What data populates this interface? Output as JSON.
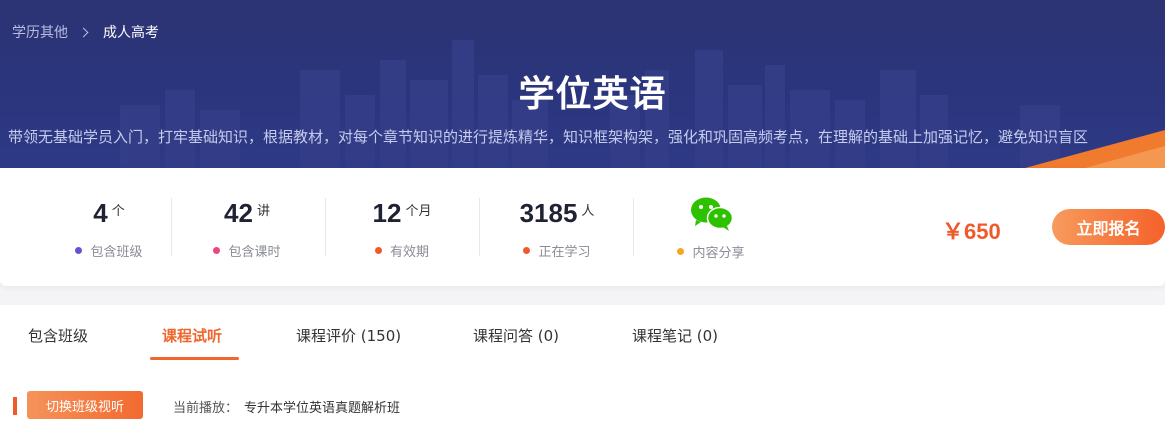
{
  "breadcrumb": {
    "parent": "学历其他",
    "current": "成人高考"
  },
  "title": "学位英语",
  "description": "带领无基础学员入门，打牢基础知识，根据教材，对每个章节知识的进行提炼精华，知识框架构架，强化和巩固高频考点，在理解的基础上加强记忆，避免知识盲区",
  "stats": [
    {
      "value": "4",
      "unit": "个",
      "label": "包含班级",
      "dot_color": "#6a4fd0"
    },
    {
      "value": "42",
      "unit": "讲",
      "label": "包含课时",
      "dot_color": "#f0457c"
    },
    {
      "value": "12",
      "unit": "个月",
      "label": "有效期",
      "dot_color": "#f05a2a"
    },
    {
      "value": "3185",
      "unit": "人",
      "label": "正在学习",
      "dot_color": "#f05a2a"
    }
  ],
  "share": {
    "label": "内容分享",
    "icon": "wechat-icon",
    "dot_color": "#f5a623"
  },
  "price": "￥650",
  "signup_label": "立即报名",
  "tabs": [
    {
      "label": "包含班级"
    },
    {
      "label": "课程试听"
    },
    {
      "label": "课程评价 (150)"
    },
    {
      "label": "课程问答 (0)"
    },
    {
      "label": "课程笔记 (0)"
    }
  ],
  "active_tab": "课程试听",
  "player": {
    "switch_label": "切换班级视听",
    "current_label": "当前播放：",
    "current_value": "专升本学位英语真题解析班"
  },
  "colors": {
    "accent": "#f0662d",
    "banner": "#2b357d"
  }
}
